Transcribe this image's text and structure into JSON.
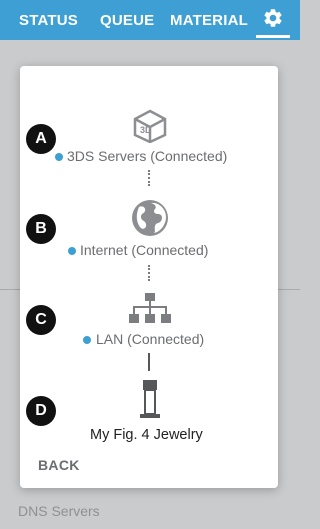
{
  "nav": {
    "tabs": [
      {
        "label": "STATUS"
      },
      {
        "label": "QUEUE"
      },
      {
        "label": "MATERIAL"
      }
    ],
    "settings_icon": "gear-icon",
    "accent_color": "#3d9fd3"
  },
  "background": {
    "bottom_text": "DNS Servers"
  },
  "dialog": {
    "steps": [
      {
        "marker": "A",
        "icon": "3ds-logo-icon",
        "label": "3DS Servers (Connected)",
        "status_color": "#3d9fd3"
      },
      {
        "marker": "B",
        "icon": "globe-icon",
        "label": "Internet (Connected)",
        "status_color": "#3d9fd3"
      },
      {
        "marker": "C",
        "icon": "network-icon",
        "label": "LAN (Connected)",
        "status_color": "#3d9fd3"
      },
      {
        "marker": "D",
        "icon": "printer-icon",
        "label": "My Fig. 4 Jewelry"
      }
    ],
    "back_label": "BACK"
  }
}
